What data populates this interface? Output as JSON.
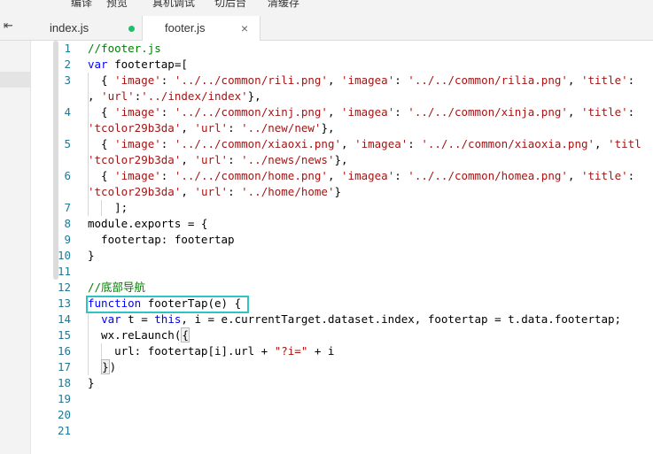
{
  "toolbar": {
    "items": [
      "编译",
      "预览",
      "真机调试",
      "切后台",
      "清缓存"
    ]
  },
  "tabs": [
    {
      "label": "index.js",
      "modified": true
    },
    {
      "label": "footer.js",
      "modified": false
    }
  ],
  "tab_close_glyph": "×",
  "collapse_glyph": "⇤",
  "editor": {
    "line_numbers": [
      "1",
      "2",
      "3",
      "",
      "4",
      "",
      "5",
      "",
      "6",
      "",
      "7",
      "8",
      "9",
      "10",
      "11",
      "12",
      "13",
      "14",
      "15",
      "16",
      "17",
      "18",
      "19",
      "20",
      "21"
    ],
    "lines": {
      "l1": "//footer.js",
      "l2_kw": "var",
      "l2_rest": " footertap=[",
      "l3a_p1": "  { ",
      "l3a_s1": "'image'",
      "l3a_p2": ": ",
      "l3a_s2": "'../../common/rili.png'",
      "l3a_p3": ", ",
      "l3a_s3": "'imagea'",
      "l3a_p4": ": ",
      "l3a_s4": "'../../common/rilia.png'",
      "l3a_p5": ", ",
      "l3a_s5": "'title'",
      "l3a_p6": ":",
      "l3b_p1": ", ",
      "l3b_s1": "'url'",
      "l3b_p2": ":",
      "l3b_s2": "'../index/index'",
      "l3b_p3": "},",
      "l4a_p1": "  { ",
      "l4a_s1": "'image'",
      "l4a_p2": ": ",
      "l4a_s2": "'../../common/xinj.png'",
      "l4a_p3": ", ",
      "l4a_s3": "'imagea'",
      "l4a_p4": ": ",
      "l4a_s4": "'../../common/xinja.png'",
      "l4a_p5": ", ",
      "l4a_s5": "'title'",
      "l4a_p6": ":",
      "l4b_s1": "'tcolor29b3da'",
      "l4b_p1": ", ",
      "l4b_s2": "'url'",
      "l4b_p2": ": ",
      "l4b_s3": "'../new/new'",
      "l4b_p3": "},",
      "l5a_p1": "  { ",
      "l5a_s1": "'image'",
      "l5a_p2": ": ",
      "l5a_s2": "'../../common/xiaoxi.png'",
      "l5a_p3": ", ",
      "l5a_s3": "'imagea'",
      "l5a_p4": ": ",
      "l5a_s4": "'../../common/xiaoxia.png'",
      "l5a_p5": ", ",
      "l5a_s5": "'titl",
      "l5b_s1": "'tcolor29b3da'",
      "l5b_p1": ", ",
      "l5b_s2": "'url'",
      "l5b_p2": ": ",
      "l5b_s3": "'../news/news'",
      "l5b_p3": "},",
      "l6a_p1": "  { ",
      "l6a_s1": "'image'",
      "l6a_p2": ": ",
      "l6a_s2": "'../../common/home.png'",
      "l6a_p3": ", ",
      "l6a_s3": "'imagea'",
      "l6a_p4": ": ",
      "l6a_s4": "'../../common/homea.png'",
      "l6a_p5": ", ",
      "l6a_s5": "'title'",
      "l6a_p6": ":",
      "l6b_s1": "'tcolor29b3da'",
      "l6b_p1": ", ",
      "l6b_s2": "'url'",
      "l6b_p2": ": ",
      "l6b_s3": "'../home/home'",
      "l6b_p3": "}",
      "l7": "    ];",
      "l8": "module.exports = {",
      "l9": "  footertap: footertap",
      "l10": "}",
      "l12": "//底部导航",
      "l13_kw": "function",
      "l13_rest": " footerTap(e) {",
      "l14_p1": "  ",
      "l14_kw1": "var",
      "l14_p2": " t = ",
      "l14_kw2": "this",
      "l14_p3": ", i = e.currentTarget.dataset.index, footertap = t.data.footertap;",
      "l15_p1": "  wx.reLaunch(",
      "l15_br": "{",
      "l16_p1": "    url: footertap[i].url + ",
      "l16_s1": "\"?i=\"",
      "l16_p2": " + i",
      "l17_p1": "  ",
      "l17_br": "}",
      "l17_p2": ")",
      "l18": "}"
    }
  },
  "colors": {
    "keyword": "#0000ff",
    "string": "#a31515",
    "comment": "#008000",
    "line_number": "#237893",
    "highlight_box": "#2ec4c4",
    "modified_dot": "#1fbf6a"
  }
}
